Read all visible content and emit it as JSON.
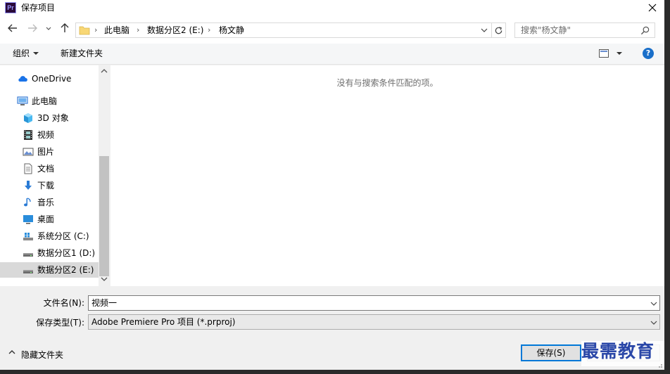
{
  "window": {
    "title": "保存项目",
    "app_icon_text": "Pr"
  },
  "navigation": {
    "breadcrumbs": [
      "此电脑",
      "数据分区2 (E:)",
      "杨文静"
    ],
    "search_placeholder": "搜索\"杨文静\""
  },
  "toolbar": {
    "organize_label": "组织",
    "new_folder_label": "新建文件夹",
    "help_label": "?"
  },
  "sidebar": {
    "items": [
      {
        "label": "OneDrive",
        "icon": "cloud-icon",
        "level": 0
      },
      {
        "label": "此电脑",
        "icon": "computer-icon",
        "level": 0
      },
      {
        "label": "3D 对象",
        "icon": "cube-icon",
        "level": 1
      },
      {
        "label": "视频",
        "icon": "film-icon",
        "level": 1
      },
      {
        "label": "图片",
        "icon": "picture-icon",
        "level": 1
      },
      {
        "label": "文档",
        "icon": "document-icon",
        "level": 1
      },
      {
        "label": "下载",
        "icon": "download-icon",
        "level": 1
      },
      {
        "label": "音乐",
        "icon": "music-icon",
        "level": 1
      },
      {
        "label": "桌面",
        "icon": "desktop-icon",
        "level": 1
      },
      {
        "label": "系统分区 (C:)",
        "icon": "system-drive-icon",
        "level": 1
      },
      {
        "label": "数据分区1 (D:)",
        "icon": "drive-icon",
        "level": 1
      },
      {
        "label": "数据分区2 (E:)",
        "icon": "drive-icon",
        "level": 1,
        "selected": true
      }
    ]
  },
  "content": {
    "empty_message": "没有与搜索条件匹配的项。"
  },
  "form": {
    "filename_label": "文件名(N):",
    "filename_value": "视频一",
    "filetype_label": "保存类型(T):",
    "filetype_value": "Adobe Premiere Pro 项目 (*.prproj)"
  },
  "footer": {
    "hide_folders_label": "隐藏文件夹",
    "save_label": "保存(S)",
    "watermark": "最需教育"
  },
  "colors": {
    "accent": "#0078d7",
    "selected_bg": "#d9d9d9",
    "watermark": "#2a47a8"
  }
}
